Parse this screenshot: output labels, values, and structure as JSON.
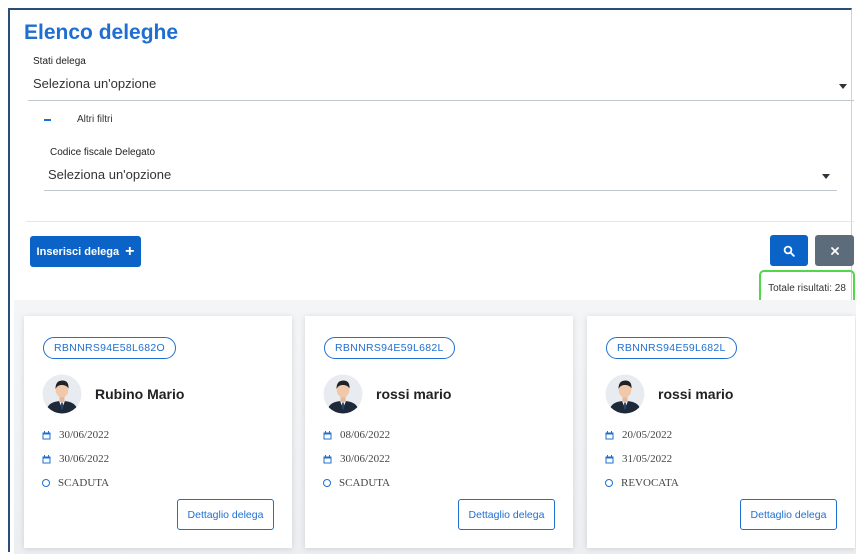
{
  "page": {
    "title": "Elenco deleghe"
  },
  "filters": {
    "stati_label": "Stati delega",
    "stati_value": "Seleziona un'opzione",
    "altri_filtri_label": "Altri filtri",
    "codice_label": "Codice fiscale Delegato",
    "codice_value": "Seleziona un'opzione"
  },
  "actions": {
    "insert_label": "Inserisci delega",
    "search_icon": "search-icon",
    "clear_icon": "close-icon"
  },
  "results": {
    "total_label": "Totale risultati: 28"
  },
  "cards": [
    {
      "code": "RBNNRS94E58L682O",
      "name": "Rubino Mario",
      "date_start": "30/06/2022",
      "date_end": "30/06/2022",
      "status": "SCADUTA",
      "detail_label": "Dettaglio delega"
    },
    {
      "code": "RBNNRS94E59L682L",
      "name": "rossi mario",
      "date_start": "08/06/2022",
      "date_end": "30/06/2022",
      "status": "SCADUTA",
      "detail_label": "Dettaglio delega"
    },
    {
      "code": "RBNNRS94E59L682L",
      "name": "rossi mario",
      "date_start": "20/05/2022",
      "date_end": "31/05/2022",
      "status": "REVOCATA",
      "detail_label": "Dettaglio delega"
    }
  ],
  "colors": {
    "primary": "#0b63c7",
    "title": "#1f6fd0",
    "secondary_button": "#5d6c7b",
    "highlight": "#52d64a"
  }
}
